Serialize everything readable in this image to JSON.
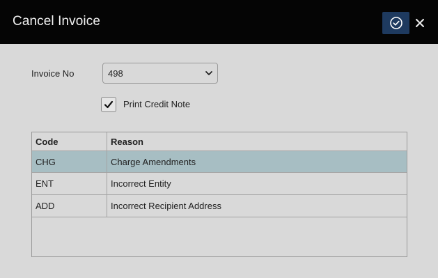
{
  "dialog": {
    "title": "Cancel Invoice",
    "confirm_icon": "check-circle-icon",
    "close_icon": "close-icon"
  },
  "form": {
    "invoice_label": "Invoice No",
    "invoice_value": "498",
    "print_credit_note": {
      "label": "Print Credit Note",
      "checked": true
    }
  },
  "table": {
    "columns": [
      "Code",
      "Reason"
    ],
    "rows": [
      {
        "code": "CHG",
        "reason": "Charge Amendments",
        "selected": true
      },
      {
        "code": "ENT",
        "reason": "Incorrect Entity",
        "selected": false
      },
      {
        "code": "ADD",
        "reason": "Incorrect Recipient Address",
        "selected": false
      }
    ]
  },
  "colors": {
    "titlebar": "#050505",
    "background": "#d9d9d9",
    "confirm_button": "#1e3a5f",
    "selected_row": "#a7bec3"
  }
}
